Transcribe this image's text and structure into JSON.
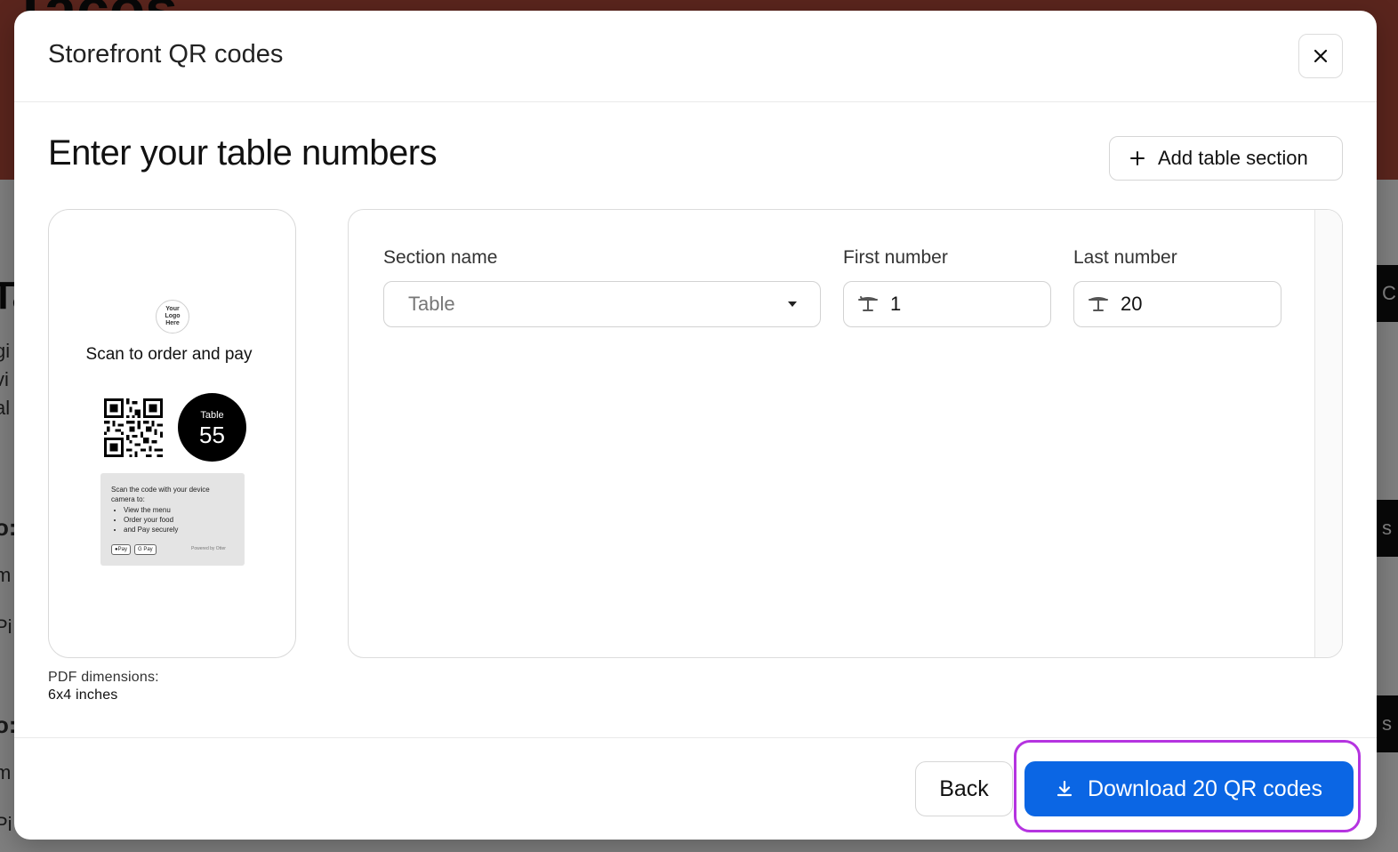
{
  "background": {
    "title": "Tacos",
    "heading": "Ta",
    "lines": [
      "gi",
      "vi",
      "al"
    ],
    "labels": [
      "o:",
      "m",
      "Pi",
      "o:",
      "m",
      "Pi"
    ],
    "right_buttons": [
      "C",
      "s",
      "s"
    ]
  },
  "modal": {
    "title": "Storefront QR codes",
    "close_label": "×"
  },
  "section": {
    "title": "Enter your table numbers",
    "add_button_label": "Add table section"
  },
  "preview": {
    "logo_text": [
      "Your",
      "Logo",
      "Here"
    ],
    "scan_title": "Scan to order and pay",
    "table_label": "Table",
    "table_number": "55",
    "info_intro": "Scan the code with your device camera to:",
    "info_items": [
      "View the menu",
      "Order your food",
      "and Pay securely"
    ],
    "pay_apple": "Pay",
    "pay_google": "G Pay",
    "powered_by": "Powered by Otter",
    "dimensions_label": "PDF dimensions:",
    "dimensions_value": "6x4 inches"
  },
  "table_section": {
    "section_name_label": "Section name",
    "section_name_value": "Table",
    "first_number_label": "First number",
    "first_number_value": "1",
    "last_number_label": "Last number",
    "last_number_value": "20"
  },
  "footer": {
    "back_label": "Back",
    "download_label": "Download 20 QR codes",
    "download_color": "#0b66e4",
    "highlight_color": "#b534e0"
  }
}
